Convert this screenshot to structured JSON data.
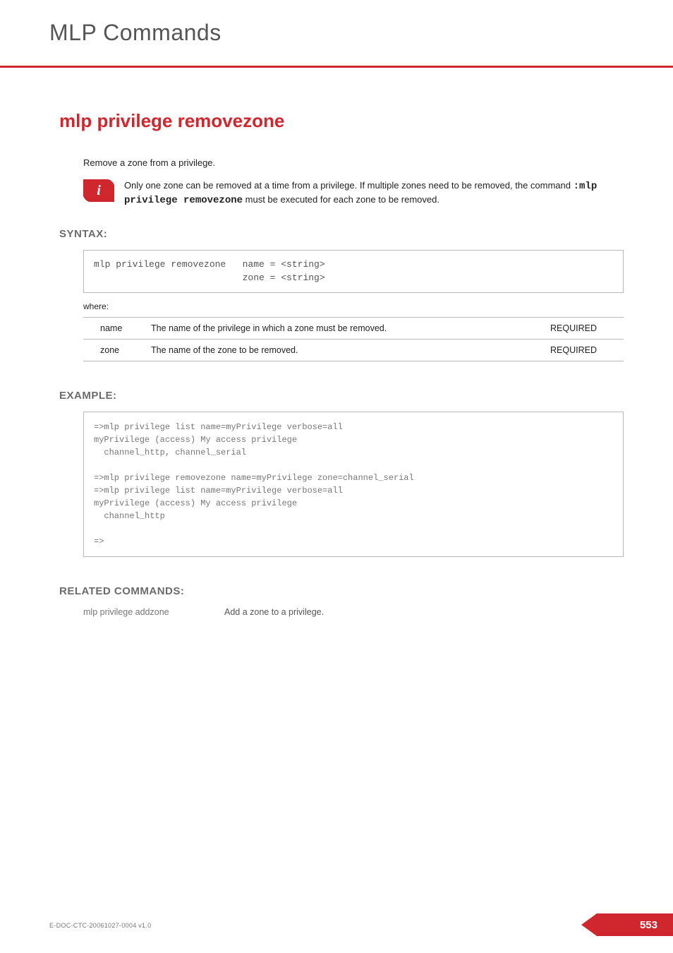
{
  "chapter_title": "MLP Commands",
  "section_title": "mlp privilege removezone",
  "intro": "Remove a zone from a privilege.",
  "info_note": {
    "pre": "Only one zone can be removed at a time from a privilege. If multiple zones need to be removed, the command ",
    "cmd": ":mlp privilege removezone",
    "post": " must be executed for each zone to be removed."
  },
  "headings": {
    "syntax": "SYNTAX:",
    "example": "EXAMPLE:",
    "related": "RELATED COMMANDS:"
  },
  "syntax_text": "mlp privilege removezone   name = <string>\n                           zone = <string>",
  "where_label": "where:",
  "params": [
    {
      "name": "name",
      "desc": "The name of the privilege in which a zone must be removed.",
      "req": "REQUIRED"
    },
    {
      "name": "zone",
      "desc": "The name of the zone to be removed.",
      "req": "REQUIRED"
    }
  ],
  "example_text": "=>mlp privilege list name=myPrivilege verbose=all\nmyPrivilege (access) My access privilege\n  channel_http, channel_serial\n\n=>mlp privilege removezone name=myPrivilege zone=channel_serial\n=>mlp privilege list name=myPrivilege verbose=all\nmyPrivilege (access) My access privilege\n  channel_http\n\n=>",
  "related": [
    {
      "name": "mlp privilege addzone",
      "desc": "Add a zone to a privilege."
    }
  ],
  "footer": {
    "docref": "E-DOC-CTC-20061027-0004 v1.0",
    "pagenum": "553"
  }
}
